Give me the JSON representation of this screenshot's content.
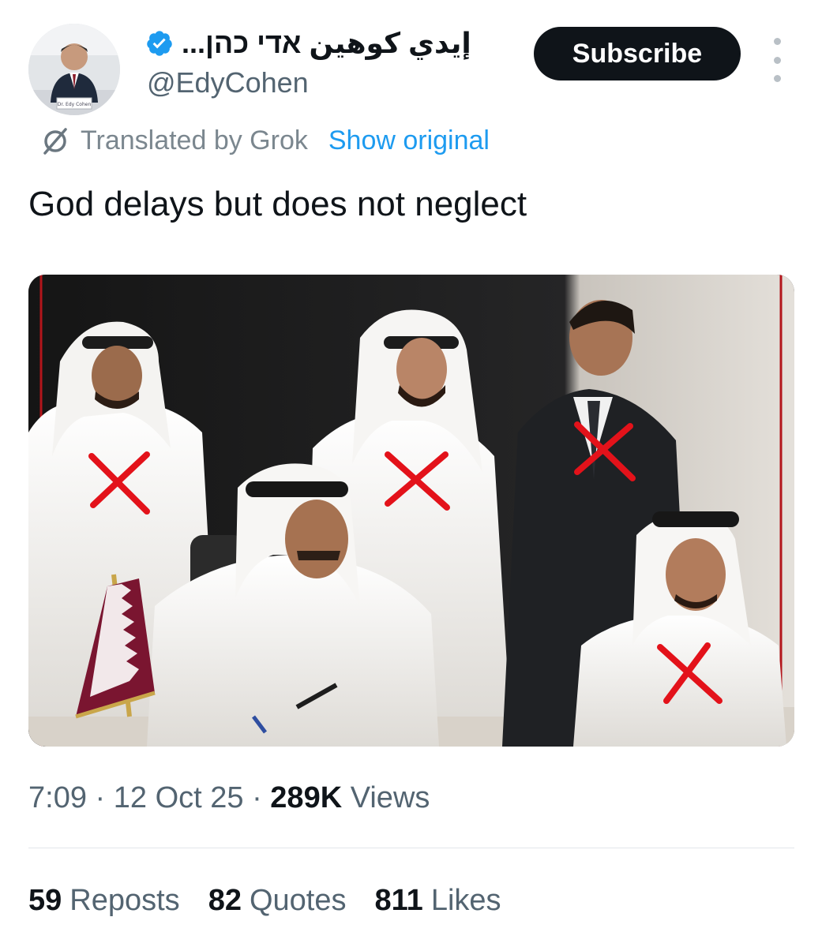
{
  "author": {
    "display_name": "إيدي كوهين אדי כהן...",
    "handle": "@EdyCohen",
    "verified": true,
    "avatar_placard": "Dr. Edy Cohen"
  },
  "actions": {
    "subscribe_label": "Subscribe"
  },
  "translation": {
    "label": "Translated by Grok",
    "show_original_label": "Show original"
  },
  "tweet": {
    "text": "God delays but does not neglect"
  },
  "meta": {
    "time": "7:09",
    "separator": "·",
    "date": "12 Oct 25",
    "views_count": "289K",
    "views_label": "Views"
  },
  "stats": {
    "reposts_count": "59",
    "reposts_label": "Reposts",
    "quotes_count": "82",
    "quotes_label": "Quotes",
    "likes_count": "811",
    "likes_label": "Likes"
  },
  "colors": {
    "accent_blue": "#1d9bf0",
    "cross_red": "#e3121a",
    "qatar_maroon": "#7a1530"
  }
}
